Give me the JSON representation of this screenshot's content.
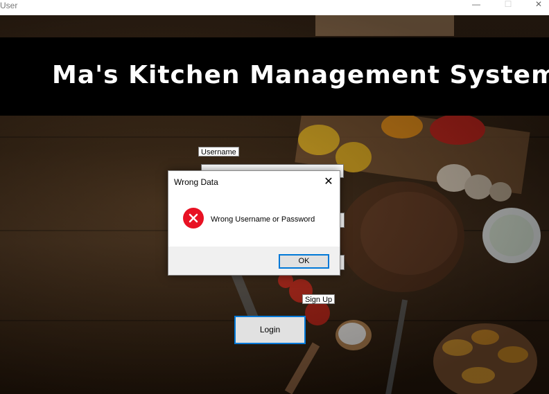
{
  "window": {
    "title": "User",
    "controls": {
      "minimize": "—",
      "maximize": "☐",
      "close": "✕"
    }
  },
  "header": {
    "title": "Ma's Kitchen Management System"
  },
  "form": {
    "username_label": "Username",
    "signup_label": "Sign Up",
    "login_label": "Login"
  },
  "dialog": {
    "title": "Wrong Data",
    "close_glyph": "✕",
    "message": "Wrong Username or Password",
    "ok_label": "OK",
    "icon": "error-icon"
  },
  "colors": {
    "accent": "#0078d7",
    "error": "#e81123",
    "header_band": "#000000"
  }
}
